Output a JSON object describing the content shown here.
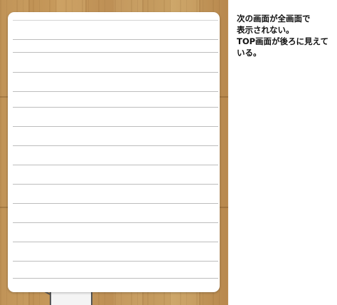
{
  "annotation": {
    "lines": [
      "次の画面が全画面で",
      "表示されない。",
      "TOP画面が後ろに見えて",
      "いる。"
    ]
  },
  "note_sheet": {
    "ruled_line_count": 14
  },
  "colors": {
    "wood": "#c29556",
    "paper": "#ffffff",
    "rule": "#bdbdbd",
    "annotation_text": "#111111"
  }
}
